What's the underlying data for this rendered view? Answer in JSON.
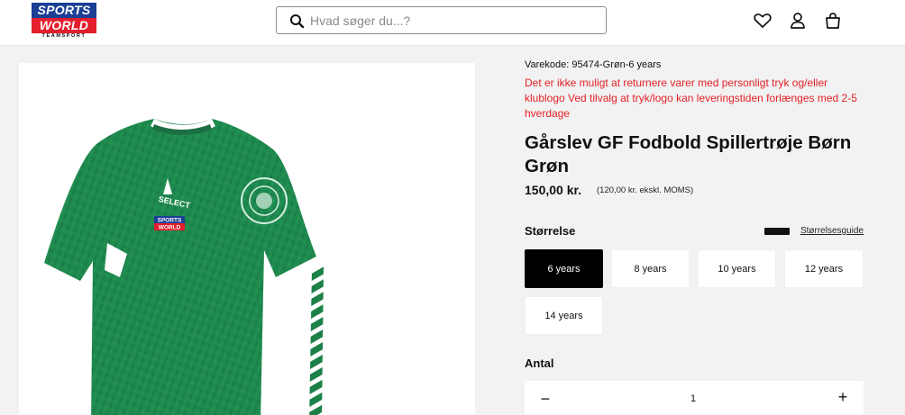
{
  "header": {
    "logo": {
      "line1": "SPORTS",
      "line2": "WORLD",
      "line3": "TEAMSPORT"
    },
    "search": {
      "placeholder": "Hvad søger du...?"
    },
    "icons": [
      "heart-icon",
      "user-icon",
      "bag-icon"
    ]
  },
  "product": {
    "sku": "Varekode: 95474-Grøn-6 years",
    "notice": "Det er ikke muligt at returnere varer med personligt tryk og/eller klublogo Ved tilvalg at tryk/logo kan leveringstiden forlænges med 2-5 hverdage",
    "title": "Gårslev GF Fodbold Spillertrøje Børn Grøn",
    "price": "150,00 kr.",
    "price_ex_vat": "(120,00 kr. ekskl. MOMS)",
    "image_alt": "Green football jersey",
    "jersey_brand": "SELECT",
    "jersey_sponsor_1": "SPORTS",
    "jersey_sponsor_2": "WORLD"
  },
  "size": {
    "label": "Størrelse",
    "guide_label": "Størrelsesguide",
    "options": [
      "6 years",
      "8 years",
      "10 years",
      "12 years",
      "14 years"
    ],
    "selected": "6 years"
  },
  "quantity": {
    "label": "Antal",
    "minus": "−",
    "value": "1",
    "plus": "+"
  },
  "colors": {
    "notice": "#e41f26",
    "jersey_green": "#1f8a4e",
    "selected_bg": "#000000"
  }
}
